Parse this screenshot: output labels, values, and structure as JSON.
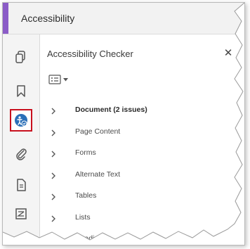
{
  "header": {
    "title": "Accessibility"
  },
  "panel": {
    "title": "Accessibility Checker",
    "close_glyph": "✕",
    "items": [
      {
        "label": "Document (2 issues)",
        "bold": true
      },
      {
        "label": "Page Content"
      },
      {
        "label": "Forms"
      },
      {
        "label": "Alternate Text"
      },
      {
        "label": "Tables"
      },
      {
        "label": "Lists"
      },
      {
        "label": "Headings"
      }
    ]
  },
  "rail": {
    "icons": [
      "pages-icon",
      "bookmark-icon",
      "accessibility-icon",
      "attachment-icon",
      "document-icon",
      "tags-icon",
      "layers-icon"
    ],
    "selected": "accessibility-icon"
  },
  "colors": {
    "accent": "#8b5cc7",
    "selection": "#c8101e",
    "accessibility_blue": "#2a6fb8"
  }
}
